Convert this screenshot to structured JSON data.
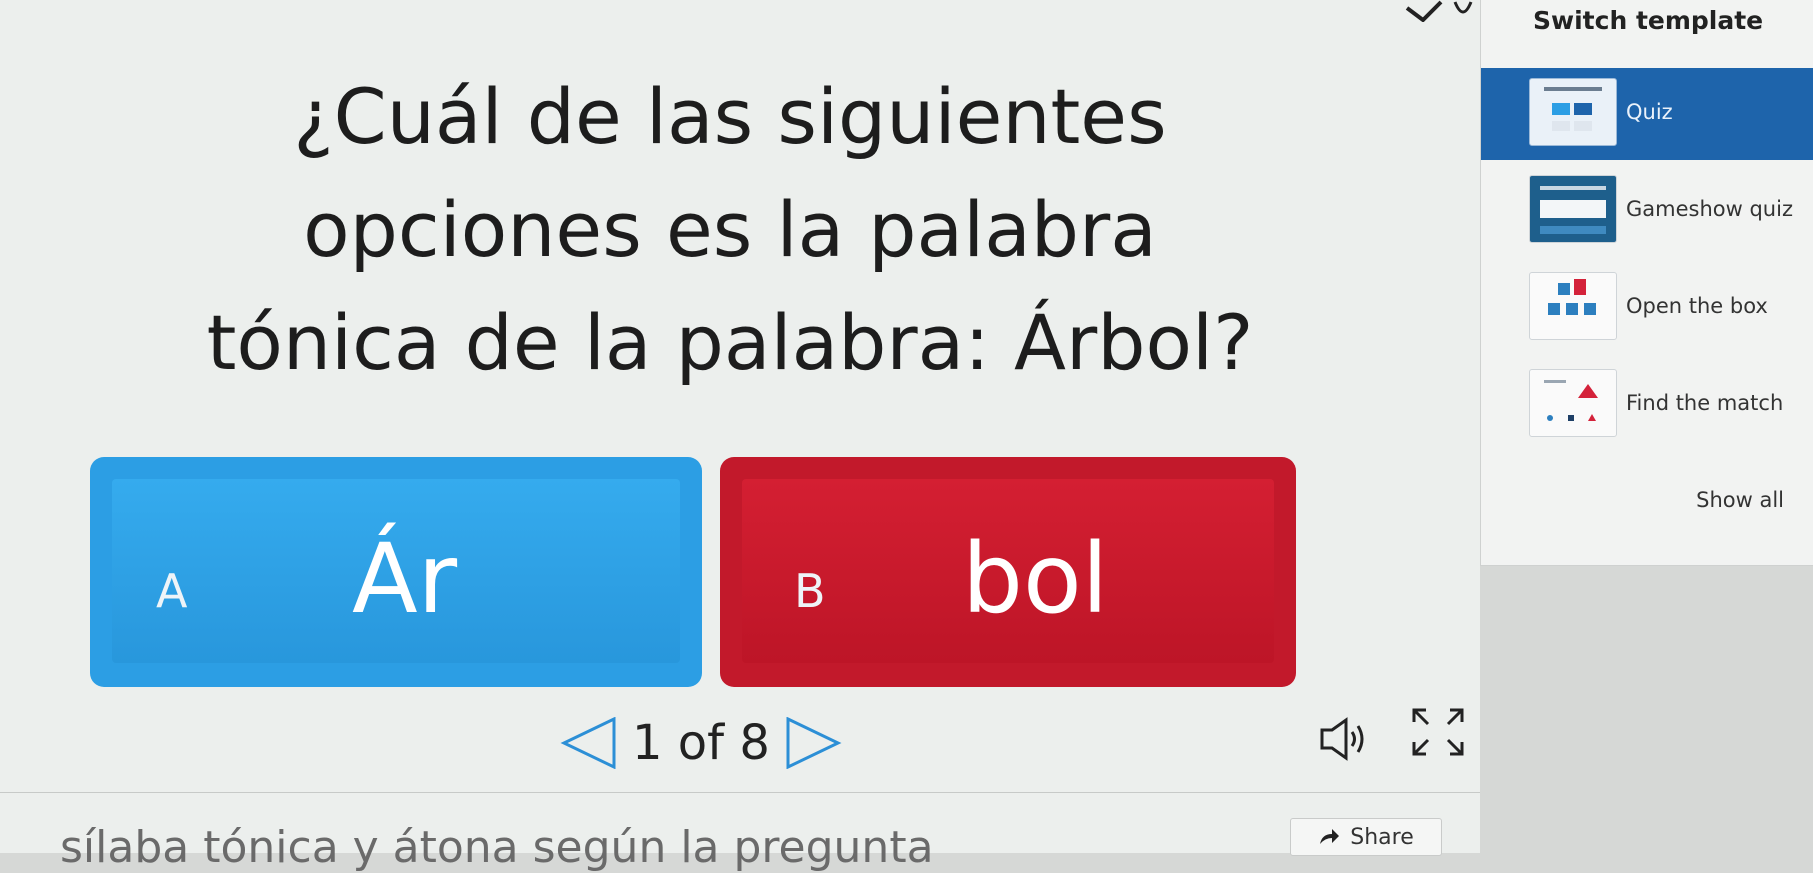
{
  "question": {
    "lines": [
      "¿Cuál de las siguientes",
      "opciones es la palabra",
      "tónica de la palabra: Árbol?"
    ]
  },
  "answers": [
    {
      "letter": "A",
      "text": "Ár",
      "color": "#2c9ee4"
    },
    {
      "letter": "B",
      "text": "bol",
      "color": "#c2192b"
    }
  ],
  "pager": {
    "label": "1 of 8"
  },
  "icons": {
    "prev": "prev-triangle-icon",
    "next": "next-triangle-icon",
    "sound": "speaker-icon",
    "fullscreen": "fullscreen-icon",
    "share": "share-arrow-icon",
    "check": "checkmark-icon"
  },
  "footer": {
    "text": "sílaba tónica y átona según la pregunta"
  },
  "share": {
    "label": "Share"
  },
  "panel": {
    "title": "Switch template",
    "templates": [
      {
        "label": "Quiz",
        "active": true
      },
      {
        "label": "Gameshow quiz",
        "active": false
      },
      {
        "label": "Open the box",
        "active": false
      },
      {
        "label": "Find the match",
        "active": false
      }
    ],
    "show_all": "Show all"
  },
  "colors": {
    "active_template": "#1e64ab",
    "answer_a": "#2c9ee4",
    "answer_b": "#c2192b"
  }
}
